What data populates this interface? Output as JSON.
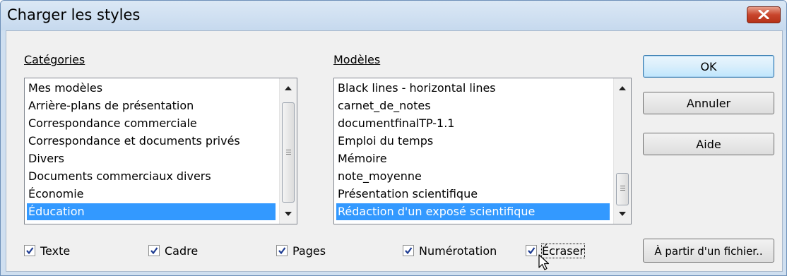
{
  "window": {
    "title": "Charger les styles"
  },
  "categories": {
    "label": "Catégories",
    "items": [
      "Mes modèles",
      "Arrière-plans de présentation",
      "Correspondance commerciale",
      "Correspondance et documents privés",
      "Divers",
      "Documents commerciaux divers",
      "Économie",
      "Éducation"
    ],
    "selected": 7
  },
  "models": {
    "label": "Modèles",
    "items": [
      "Black lines - horizontal lines",
      "carnet_de_notes",
      "documentfinalTP-1.1",
      "Emploi du temps",
      "Mémoire",
      "note_moyenne",
      "Présentation scientifique",
      "Rédaction d'un exposé scientifique"
    ],
    "selected": 7
  },
  "buttons": {
    "ok": "OK",
    "cancel": "Annuler",
    "help": "Aide",
    "from_file": "À partir d'un fichier.."
  },
  "options": [
    {
      "label": "Texte",
      "checked": true
    },
    {
      "label": "Cadre",
      "checked": true
    },
    {
      "label": "Pages",
      "checked": true
    },
    {
      "label": "Numérotation",
      "checked": true
    },
    {
      "label": "Écraser",
      "checked": true
    }
  ],
  "colors": {
    "selection": "#3399ff",
    "titlebar": "#c6d9ee",
    "dialog_bg": "#f0f0f0"
  }
}
